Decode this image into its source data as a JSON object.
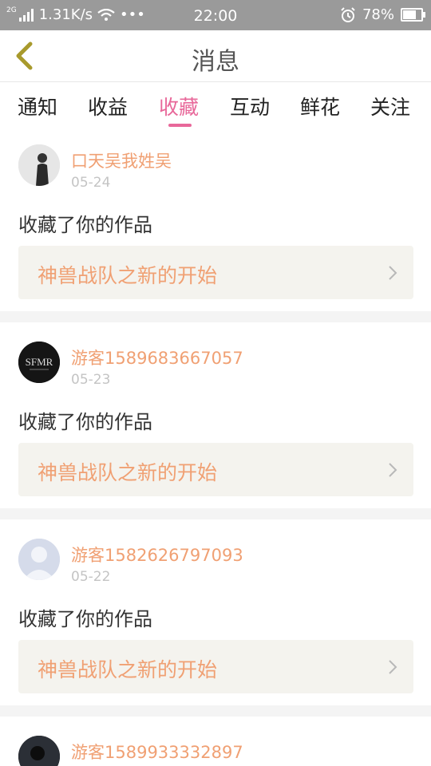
{
  "status_bar": {
    "network": "2G",
    "speed": "1.31K/s",
    "dots": "•••",
    "time": "22:00",
    "battery": "78%",
    "battery_level": 0.78
  },
  "header": {
    "title": "消息"
  },
  "tabs": [
    {
      "label": "通知"
    },
    {
      "label": "收益"
    },
    {
      "label": "收藏",
      "active": true
    },
    {
      "label": "互动"
    },
    {
      "label": "鲜花"
    },
    {
      "label": "关注"
    }
  ],
  "items": [
    {
      "user": "口天吴我姓吴",
      "date": "05-24",
      "action": "收藏了你的作品",
      "work": "神兽战队之新的开始"
    },
    {
      "user": "游客1589683667057",
      "date": "05-23",
      "action": "收藏了你的作品",
      "work": "神兽战队之新的开始"
    },
    {
      "user": "游客1582626797093",
      "date": "05-22",
      "action": "收藏了你的作品",
      "work": "神兽战队之新的开始"
    },
    {
      "user": "游客1589933332897"
    }
  ],
  "avatar2_text": "SFMR"
}
